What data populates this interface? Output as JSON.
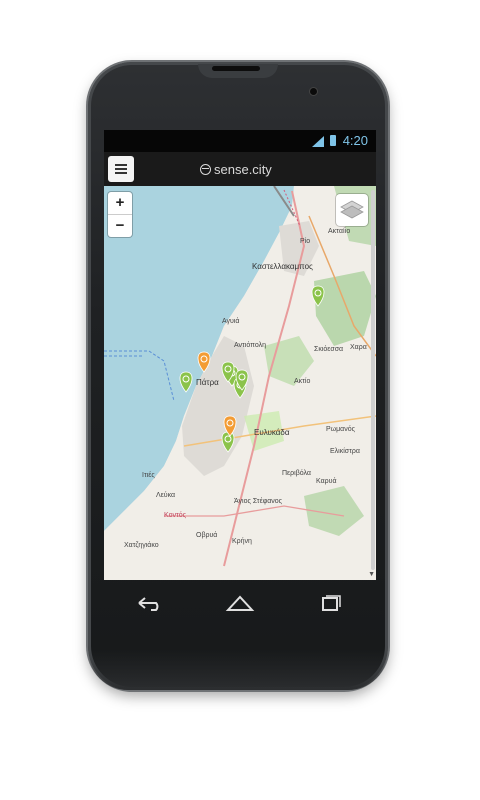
{
  "status_bar": {
    "time": "4:20"
  },
  "app_bar": {
    "menu_icon": "menu-icon",
    "app_name": "sense.city"
  },
  "map": {
    "zoom_in_label": "+",
    "zoom_out_label": "−",
    "place_labels": [
      "Ακταíiο",
      "Ρίο",
      "Καστελλακαμπος",
      "Αγυιά",
      "Ακτίο",
      "Αντιόπολη",
      "Σκιόεσσα",
      "Χαρα",
      "Πάτρα",
      "Ευλυκάδα",
      "Ρωμανός",
      "Ελικίστρα",
      "Περιβόλα",
      "Καρυά",
      "Ιτιές",
      "Λεύκα",
      "Άγιος Στέφανος",
      "Οβρυά",
      "Κρήνη",
      "Χατζηγιάκο",
      "Κοντός"
    ],
    "markers": [
      {
        "type": "green-smiley"
      },
      {
        "type": "green-smiley"
      },
      {
        "type": "green-smiley"
      },
      {
        "type": "green-smiley"
      },
      {
        "type": "green-smiley"
      },
      {
        "type": "green-smiley"
      },
      {
        "type": "green-building"
      },
      {
        "type": "orange-alert"
      },
      {
        "type": "orange-alert"
      }
    ],
    "colors": {
      "sea": "#aad3df",
      "land": "#f1eee8",
      "urban": "#dedbd6",
      "forest": "#add19e",
      "marker_green": "#8bc34a",
      "marker_orange": "#f39c34"
    }
  },
  "navbar": {
    "back_icon": "back-icon",
    "home_icon": "home-icon",
    "recents_icon": "recents-icon"
  }
}
